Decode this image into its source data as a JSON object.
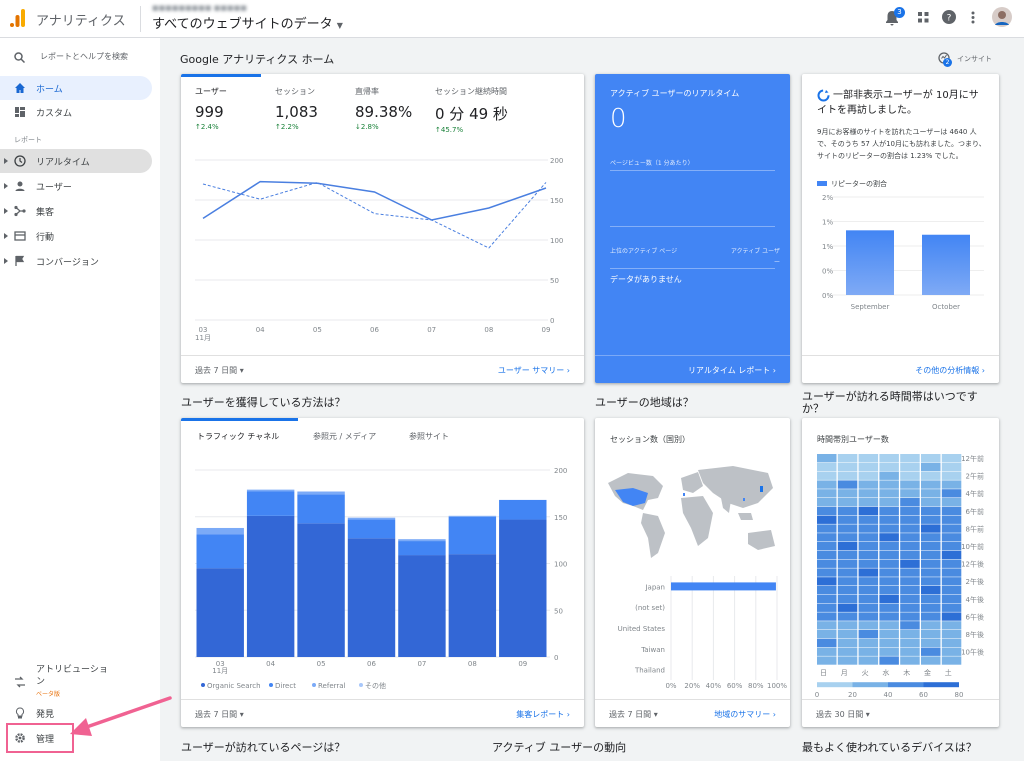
{
  "topbar": {
    "app_name": "アナリティクス",
    "account": "■■■■■■■■■ ■■■■■",
    "property": "すべてのウェブサイトのデータ",
    "notif_count": "3"
  },
  "sidebar": {
    "search": "レポートとヘルプを検索",
    "home": "ホーム",
    "custom": "カスタム",
    "section_reports": "レポート",
    "realtime": "リアルタイム",
    "users": "ユーザー",
    "acquisition": "集客",
    "behavior": "行動",
    "conversion": "コンバージョン",
    "attribution": "アトリビューション",
    "beta": "ベータ版",
    "discover": "発見",
    "admin": "管理"
  },
  "header": {
    "title": "Google アナリティクス ホーム",
    "insight": "インサイト",
    "insight_count": "2"
  },
  "home_card": {
    "metrics": [
      {
        "label": "ユーザー",
        "value": "999",
        "change": "↑2.4%"
      },
      {
        "label": "セッション",
        "value": "1,083",
        "change": "↑2.2%"
      },
      {
        "label": "直帰率",
        "value": "89.38%",
        "change": "↓2.8%"
      },
      {
        "label": "セッション継続時間",
        "value": "0 分 49 秒",
        "change": "↑45.7%"
      }
    ],
    "range": "過去 7 日間",
    "link": "ユーザー サマリー"
  },
  "realtime_card": {
    "title": "アクティブ ユーザーのリアルタイム",
    "value": "0",
    "pageviews": "ページビュー数（1 分あたり）",
    "col1": "上位のアクティブ ページ",
    "col2": "アクティブ ユーザー",
    "empty": "データがありません",
    "link": "リアルタイム レポート"
  },
  "insight_card": {
    "title": "一部非表示ユーザーが 10月にサイトを再訪しました。",
    "body": "9月にお客様のサイトを訪れたユーザーは 4640 人で、そのうち 57 人が10月にも訪れました。つまり、サイトのリピーターの割合は 1.23% でした。",
    "legend": "リピーターの割合",
    "link": "その他の分析情報"
  },
  "acq_card": {
    "tabs": [
      "トラフィック チャネル",
      "参照元 / メディア",
      "参照サイト"
    ],
    "range": "過去 7 日間",
    "link": "集客レポート"
  },
  "geo_card": {
    "title": "セッション数（国別）",
    "range": "過去 7 日間",
    "link": "地域のサマリー"
  },
  "time_card": {
    "title": "時間帯別ユーザー数",
    "range": "過去 30 日間"
  },
  "sections": {
    "acq": "ユーザーを獲得している方法は？",
    "geo": "ユーザーの地域は？",
    "time": "ユーザーが訪れる時間帯はいつですか？",
    "pages": "ユーザーが訪れているページは？",
    "active": "アクティブ ユーザーの動向",
    "devices": "最もよく使われているデバイスは？"
  },
  "colors": {
    "accent": "#1a73e8",
    "realtime_bg": "#4285f4",
    "annotation": "#f06292"
  },
  "chart_data": [
    {
      "type": "line",
      "title": "",
      "x": [
        "03",
        "04",
        "05",
        "06",
        "07",
        "08",
        "09"
      ],
      "x_sub": [
        "11月",
        "",
        "",
        "",
        "",
        "",
        ""
      ],
      "ylim": [
        0,
        200
      ],
      "y_ticks": [
        "200",
        "150",
        "100",
        "50",
        "0"
      ],
      "series": [
        {
          "values": [
            127,
            173,
            171,
            160,
            125,
            140,
            165
          ]
        },
        {
          "values": [
            170,
            151,
            172,
            133,
            125,
            90,
            172
          ]
        }
      ]
    },
    {
      "type": "bar",
      "title": "",
      "categories": [
        "September",
        "October"
      ],
      "values": [
        1.32,
        1.23
      ],
      "ylim": [
        0,
        2
      ],
      "y_ticks": [
        "2%",
        "1%",
        "1%",
        "0%",
        "0%"
      ],
      "legend": "リピーターの割合"
    },
    {
      "type": "bar",
      "stacked": true,
      "title": "",
      "categories": [
        "03",
        "04",
        "05",
        "06",
        "07",
        "08",
        "09"
      ],
      "x_sub": [
        "11月",
        "",
        "",
        "",
        "",
        "",
        ""
      ],
      "ylim": [
        0,
        200
      ],
      "y_ticks": [
        "200",
        "150",
        "100",
        "50",
        "0"
      ],
      "series": [
        {
          "name": "Organic Search",
          "values": [
            95,
            151,
            143,
            127,
            109,
            110,
            147
          ]
        },
        {
          "name": "Direct",
          "values": [
            36,
            26,
            31,
            20,
            15,
            40,
            21
          ]
        },
        {
          "name": "Referral",
          "values": [
            7,
            2,
            3,
            2,
            2,
            1,
            0
          ]
        },
        {
          "name": "その他",
          "values": [
            0,
            0,
            0,
            0,
            0,
            0,
            0
          ]
        }
      ]
    },
    {
      "type": "bar",
      "orientation": "horizontal",
      "title": "",
      "categories": [
        "Japan",
        "(not set)",
        "United States",
        "Taiwan",
        "Thailand"
      ],
      "values": [
        99,
        0,
        0,
        0,
        0
      ],
      "x_ticks": [
        "0%",
        "20%",
        "40%",
        "60%",
        "80%",
        "100%"
      ]
    },
    {
      "type": "heatmap",
      "title": "",
      "columns": [
        "日",
        "月",
        "火",
        "水",
        "木",
        "金",
        "土"
      ],
      "rows": [
        "12午前",
        "2午前",
        "4午前",
        "6午前",
        "8午前",
        "10午前",
        "12午後",
        "2午後",
        "4午後",
        "6午後",
        "8午後",
        "10午後"
      ],
      "scale": [
        "0",
        "20",
        "40",
        "60",
        "80"
      ]
    }
  ]
}
